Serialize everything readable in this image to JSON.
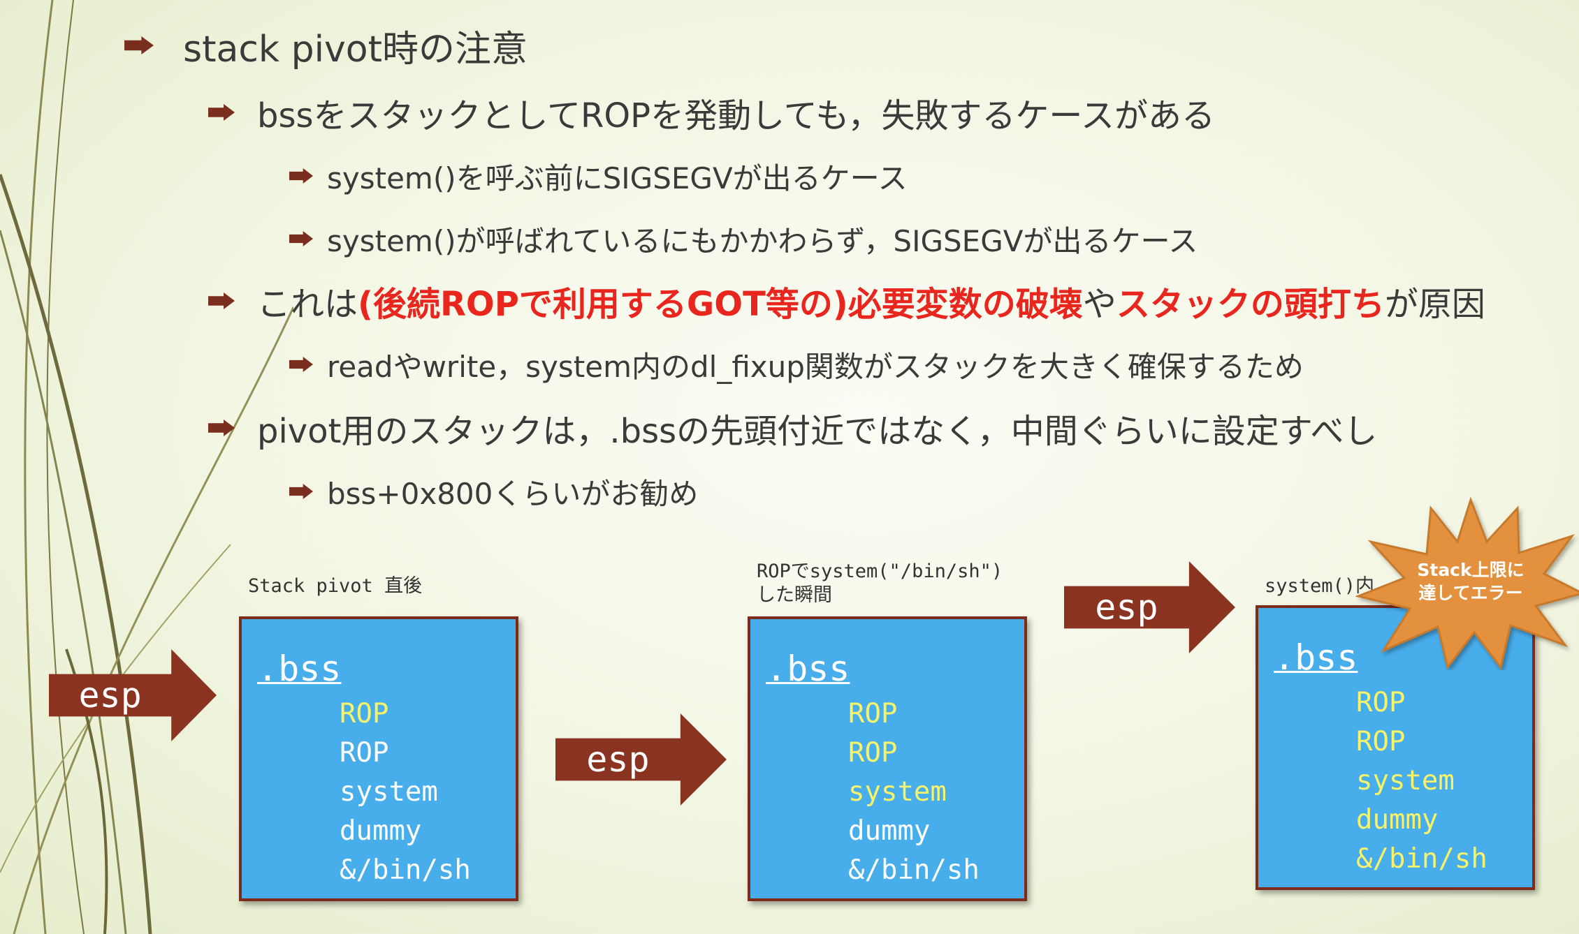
{
  "slide": {
    "bullets": [
      {
        "level": 1,
        "text": "stack pivot時の注意"
      },
      {
        "level": 2,
        "text": "bssをスタックとしてROPを発動しても，失敗するケースがある"
      },
      {
        "level": 3,
        "text": "system()を呼ぶ前にSIGSEGVが出るケース"
      },
      {
        "level": 3,
        "text": "system()が呼ばれているにもかかわらず，SIGSEGVが出るケース"
      },
      {
        "level": 2,
        "parts": [
          "これは",
          "(後続ROPで利用するGOT等の)必要変数の破壊",
          "や",
          "スタックの頭打ち",
          "が原因"
        ]
      },
      {
        "level": 3,
        "text": "readやwrite，system内のdl_fixup関数がスタックを大きく確保するため"
      },
      {
        "level": 2,
        "text": "pivot用のスタックは，.bssの先頭付近ではなく，中間ぐらいに設定すべし"
      },
      {
        "level": 3,
        "text": "bss+0x800くらいがお勧め"
      }
    ]
  },
  "diagram": {
    "captions": {
      "stack1": "Stack pivot 直後",
      "stack2_line1": "ROPでsystem(\"/bin/sh\")",
      "stack2_line2": "した瞬間",
      "stack3": "system()内"
    },
    "arrow_label": "esp",
    "section_label": ".bss",
    "stacks": [
      {
        "entries": [
          "ROP",
          "ROP",
          "system",
          "dummy",
          "&/bin/sh"
        ],
        "highlighted": [
          0
        ]
      },
      {
        "entries": [
          "ROP",
          "ROP",
          "system",
          "dummy",
          "&/bin/sh"
        ],
        "highlighted": [
          0,
          1,
          2
        ]
      },
      {
        "entries": [
          "ROP",
          "ROP",
          "system",
          "dummy",
          "&/bin/sh"
        ],
        "highlighted": [
          0,
          1,
          2,
          3,
          4
        ]
      }
    ],
    "burst": {
      "line1": "Stack上限に",
      "line2": "達してエラー"
    },
    "colors": {
      "box_fill": "#48adeb",
      "box_border": "#7d2b1b",
      "arrow": "#8a3320",
      "highlight": "#f6f36b",
      "emphasis": "#e8261e"
    }
  }
}
